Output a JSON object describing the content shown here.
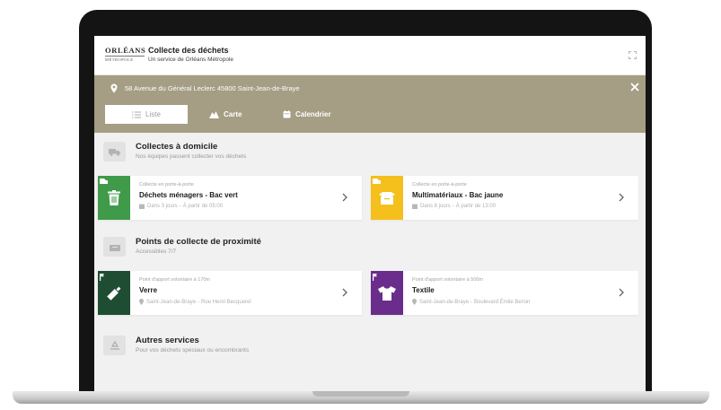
{
  "header": {
    "logo_main": "ORLÉANS",
    "logo_sub": "MÉTROPOLE",
    "title": "Collecte des déchets",
    "subtitle": "Un service de Orléans Métropole"
  },
  "address": {
    "text": "58 Avenue du Général Leclerc 45800 Saint-Jean-de-Braye"
  },
  "tabs": [
    {
      "label": "Liste",
      "active": true
    },
    {
      "label": "Carte",
      "active": false
    },
    {
      "label": "Calendrier",
      "active": false
    }
  ],
  "sections": {
    "home": {
      "title": "Collectes à domicile",
      "subtitle": "Nos équipes passent collecter vos déchets",
      "cards": [
        {
          "caption": "Collecte en porte-à-porte",
          "title": "Déchets ménagers - Bac vert",
          "meta_when": "Dans 3 jours",
          "meta_detail": "À partir de 05:00",
          "color": "#3f9a4a",
          "icon": "trash-bin-icon"
        },
        {
          "caption": "Collecte en porte-à-porte",
          "title": "Multimatériaux - Bac jaune",
          "meta_when": "Dans 8 jours",
          "meta_detail": "À partir de 13:00",
          "color": "#f5bf1c",
          "icon": "box-icon"
        }
      ]
    },
    "nearby": {
      "title": "Points de collecte de proximité",
      "subtitle": "Accessibles 7/7",
      "cards": [
        {
          "caption": "Point d'apport volontaire à 170m",
          "title": "Verre",
          "meta_place": "Saint-Jean-de-Braye",
          "meta_detail": "Rue Henri Becquerel",
          "color": "#1e4d33",
          "icon": "bottle-icon"
        },
        {
          "caption": "Point d'apport volontaire à 500m",
          "title": "Textile",
          "meta_place": "Saint-Jean-de-Braye",
          "meta_detail": "Boulevard Émile Bersin",
          "color": "#6a2d8b",
          "icon": "tshirt-icon"
        }
      ]
    },
    "other": {
      "title": "Autres services",
      "subtitle": "Pour vos déchets spéciaux ou encombrants"
    }
  },
  "colors": {
    "accent_band": "#a59d84",
    "screen_bg": "#f1f1f1"
  }
}
